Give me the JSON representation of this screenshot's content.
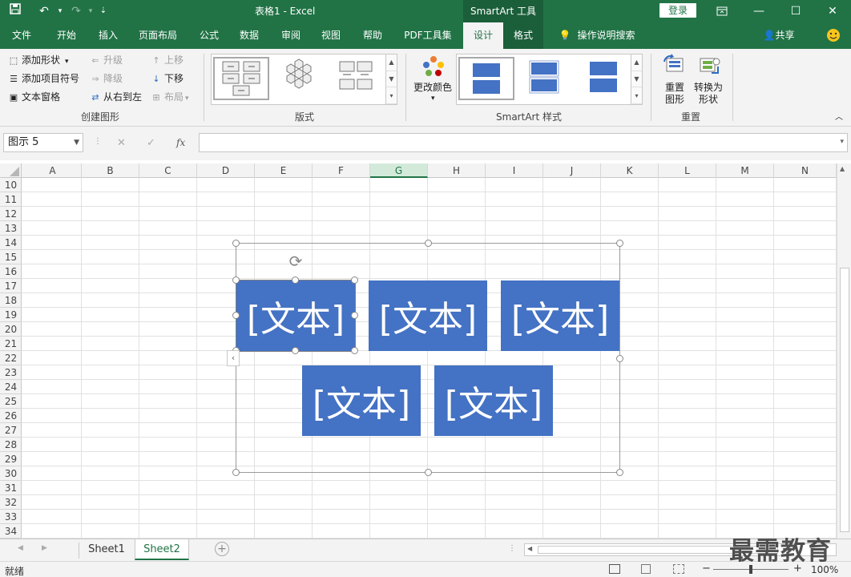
{
  "titlebar": {
    "title": "表格1  -  Excel",
    "context_title": "SmartArt 工具",
    "login_label": "登录"
  },
  "tabs": [
    {
      "label": "文件"
    },
    {
      "label": "开始"
    },
    {
      "label": "插入"
    },
    {
      "label": "页面布局"
    },
    {
      "label": "公式"
    },
    {
      "label": "数据"
    },
    {
      "label": "审阅"
    },
    {
      "label": "视图"
    },
    {
      "label": "帮助"
    },
    {
      "label": "PDF工具集"
    },
    {
      "label": "设计"
    },
    {
      "label": "格式"
    }
  ],
  "tellme": "操作说明搜索",
  "share": "共享",
  "ribbon": {
    "create": {
      "add_shape": "添加形状",
      "add_bullet": "添加项目符号",
      "text_pane": "文本窗格",
      "promote": "升级",
      "demote": "降级",
      "rtl": "从右到左",
      "move_up": "上移",
      "move_down": "下移",
      "layout": "布局",
      "group_label": "创建图形"
    },
    "layouts_label": "版式",
    "change_colors": "更改颜色",
    "styles_label": "SmartArt 样式",
    "reset_graphic_1": "重置",
    "reset_graphic_2": "图形",
    "convert_1": "转换为",
    "convert_2": "形状",
    "reset_label": "重置"
  },
  "formula_bar": {
    "name_box": "图示 5",
    "fx": "fx",
    "cancel": "✕",
    "enter": "✓"
  },
  "columns": [
    "A",
    "B",
    "C",
    "D",
    "E",
    "F",
    "G",
    "H",
    "I",
    "J",
    "K",
    "L",
    "M",
    "N"
  ],
  "selected_column": "G",
  "rows": [
    "10",
    "11",
    "12",
    "13",
    "14",
    "15",
    "16",
    "17",
    "18",
    "19",
    "20",
    "21",
    "22",
    "23",
    "24",
    "25",
    "26",
    "27",
    "28",
    "29",
    "30",
    "31",
    "32",
    "33",
    "34"
  ],
  "smartart": {
    "shapes": [
      "[文本]",
      "[文本]",
      "[文本]",
      "[文本]",
      "[文本]"
    ],
    "fill_color": "#4472c4"
  },
  "sheets": [
    {
      "name": "Sheet1",
      "active": false
    },
    {
      "name": "Sheet2",
      "active": true
    }
  ],
  "status": {
    "ready": "就绪",
    "zoom": "100%",
    "zoom_minus": "−",
    "zoom_plus": "+"
  },
  "watermark": "最需教育",
  "colors": {
    "excel_green": "#217346",
    "smartart_blue": "#4472c4"
  }
}
